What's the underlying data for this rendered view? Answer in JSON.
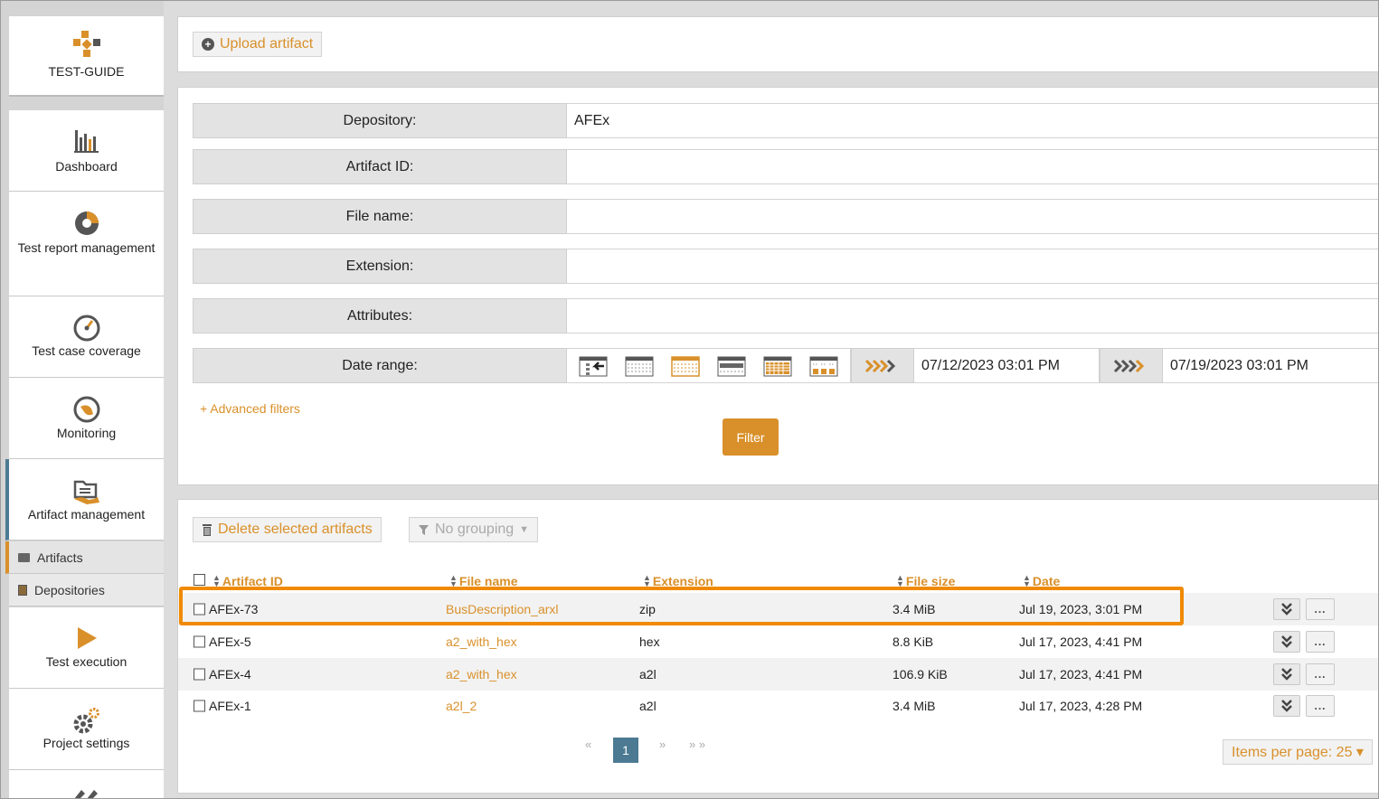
{
  "brand": {
    "name": "TEST-GUIDE",
    "accent": "#d9902a",
    "active": "#4c7a93"
  },
  "nav": [
    {
      "label": "Dashboard",
      "icon": "dashboard-icon"
    },
    {
      "label": "Test report management",
      "icon": "report-pie-icon"
    },
    {
      "label": "Test case coverage",
      "icon": "gauge-icon"
    },
    {
      "label": "Monitoring",
      "icon": "monitoring-icon"
    },
    {
      "label": "Artifact management",
      "icon": "artifact-folder-icon"
    },
    {
      "label": "Test execution",
      "icon": "play-icon"
    },
    {
      "label": "Project settings",
      "icon": "gear-icon"
    }
  ],
  "subnav": [
    {
      "label": "Artifacts",
      "icon": "folder-icon"
    },
    {
      "label": "Depositories",
      "icon": "book-icon"
    }
  ],
  "toolbar": {
    "upload_label": "Upload artifact"
  },
  "filters": {
    "depository_label": "Depository:",
    "depository_value": "AFEx",
    "artifact_id_label": "Artifact ID:",
    "file_name_label": "File name:",
    "extension_label": "Extension:",
    "attributes_label": "Attributes:",
    "date_range_label": "Date range:",
    "date_from": "07/12/2023 03:01 PM",
    "date_to": "07/19/2023 03:01 PM",
    "advanced_label": "+ Advanced filters",
    "filter_button": "Filter"
  },
  "actions": {
    "delete_label": "Delete selected artifacts",
    "grouping_label": "No grouping"
  },
  "table": {
    "headers": {
      "artifact_id": "Artifact ID",
      "file_name": "File name",
      "extension": "Extension",
      "file_size": "File size",
      "date": "Date"
    },
    "rows": [
      {
        "id": "AFEx-73",
        "file": "BusDescription_arxl",
        "ext": "zip",
        "size": "3.4 MiB",
        "date": "Jul 19, 2023, 3:01 PM"
      },
      {
        "id": "AFEx-5",
        "file": "a2_with_hex",
        "ext": "hex",
        "size": "8.8 KiB",
        "date": "Jul 17, 2023, 4:41 PM"
      },
      {
        "id": "AFEx-4",
        "file": "a2_with_hex",
        "ext": "a2l",
        "size": "106.9 KiB",
        "date": "Jul 17, 2023, 4:41 PM"
      },
      {
        "id": "AFEx-1",
        "file": "a2l_2",
        "ext": "a2l",
        "size": "3.4 MiB",
        "date": "Jul 17, 2023, 4:28 PM"
      }
    ],
    "more_label": "..."
  },
  "pagination": {
    "first": "«",
    "current": "1",
    "next": "»",
    "last": "» »",
    "items_per_page": "Items per page: 25 ▾"
  }
}
